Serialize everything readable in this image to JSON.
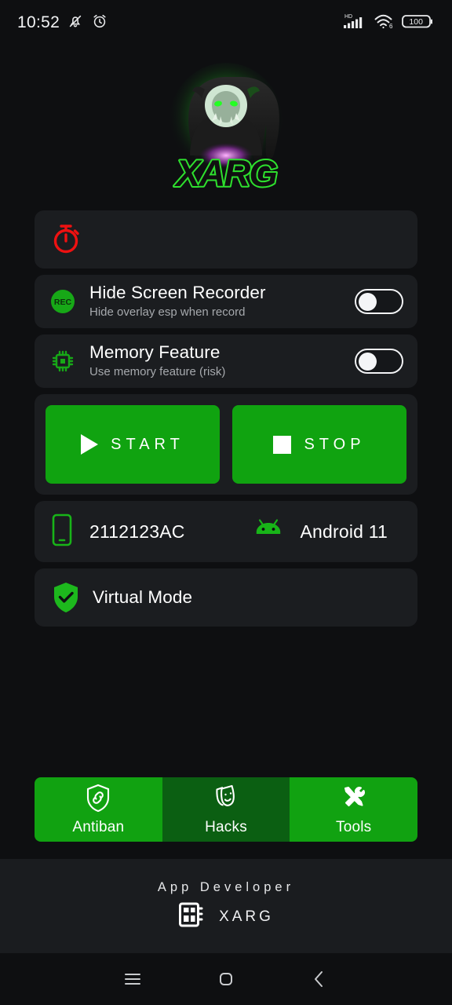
{
  "statusbar": {
    "time": "10:52",
    "icons_left": [
      "mute-icon",
      "alarm-icon"
    ],
    "network_label": "HD",
    "wifi_label": "6",
    "battery_level": "100"
  },
  "logo": {
    "brand_text": "XARG",
    "alt": "xarg-demon-logo",
    "glow_color": "#2fe02f"
  },
  "timer_card": {
    "icon": "stopwatch-icon",
    "icon_color": "#ee1111",
    "value": ""
  },
  "toggles": [
    {
      "icon": "rec-icon",
      "icon_label": "REC",
      "title": "Hide Screen Recorder",
      "subtitle": "Hide overlay esp when record",
      "state": "off"
    },
    {
      "icon": "cpu-chip-icon",
      "title": "Memory Feature",
      "subtitle": "Use memory feature (risk)",
      "state": "off"
    }
  ],
  "actions": {
    "start_label": "START",
    "stop_label": "STOP",
    "start_icon": "play-icon",
    "stop_icon": "stop-square-icon",
    "accent": "#10a310"
  },
  "device": {
    "phone_icon": "smartphone-icon",
    "model": "2112123AC",
    "android_icon": "android-robot-icon",
    "os_version": "Android 11"
  },
  "virtual_mode": {
    "icon": "shield-check-icon",
    "label": "Virtual Mode"
  },
  "bottom_nav": [
    {
      "icon": "shield-link-icon",
      "label": "Antiban",
      "active": false
    },
    {
      "icon": "theater-masks-icon",
      "label": "Hacks",
      "active": true
    },
    {
      "icon": "tools-wrench-screwdriver-icon",
      "label": "Tools",
      "active": false
    }
  ],
  "footer": {
    "title": "App Developer",
    "icon": "dashboard-grid-icon",
    "developer": "XARG"
  },
  "system_nav": {
    "recents": "menu-icon",
    "home": "home-square-icon",
    "back": "back-chevron-icon"
  }
}
